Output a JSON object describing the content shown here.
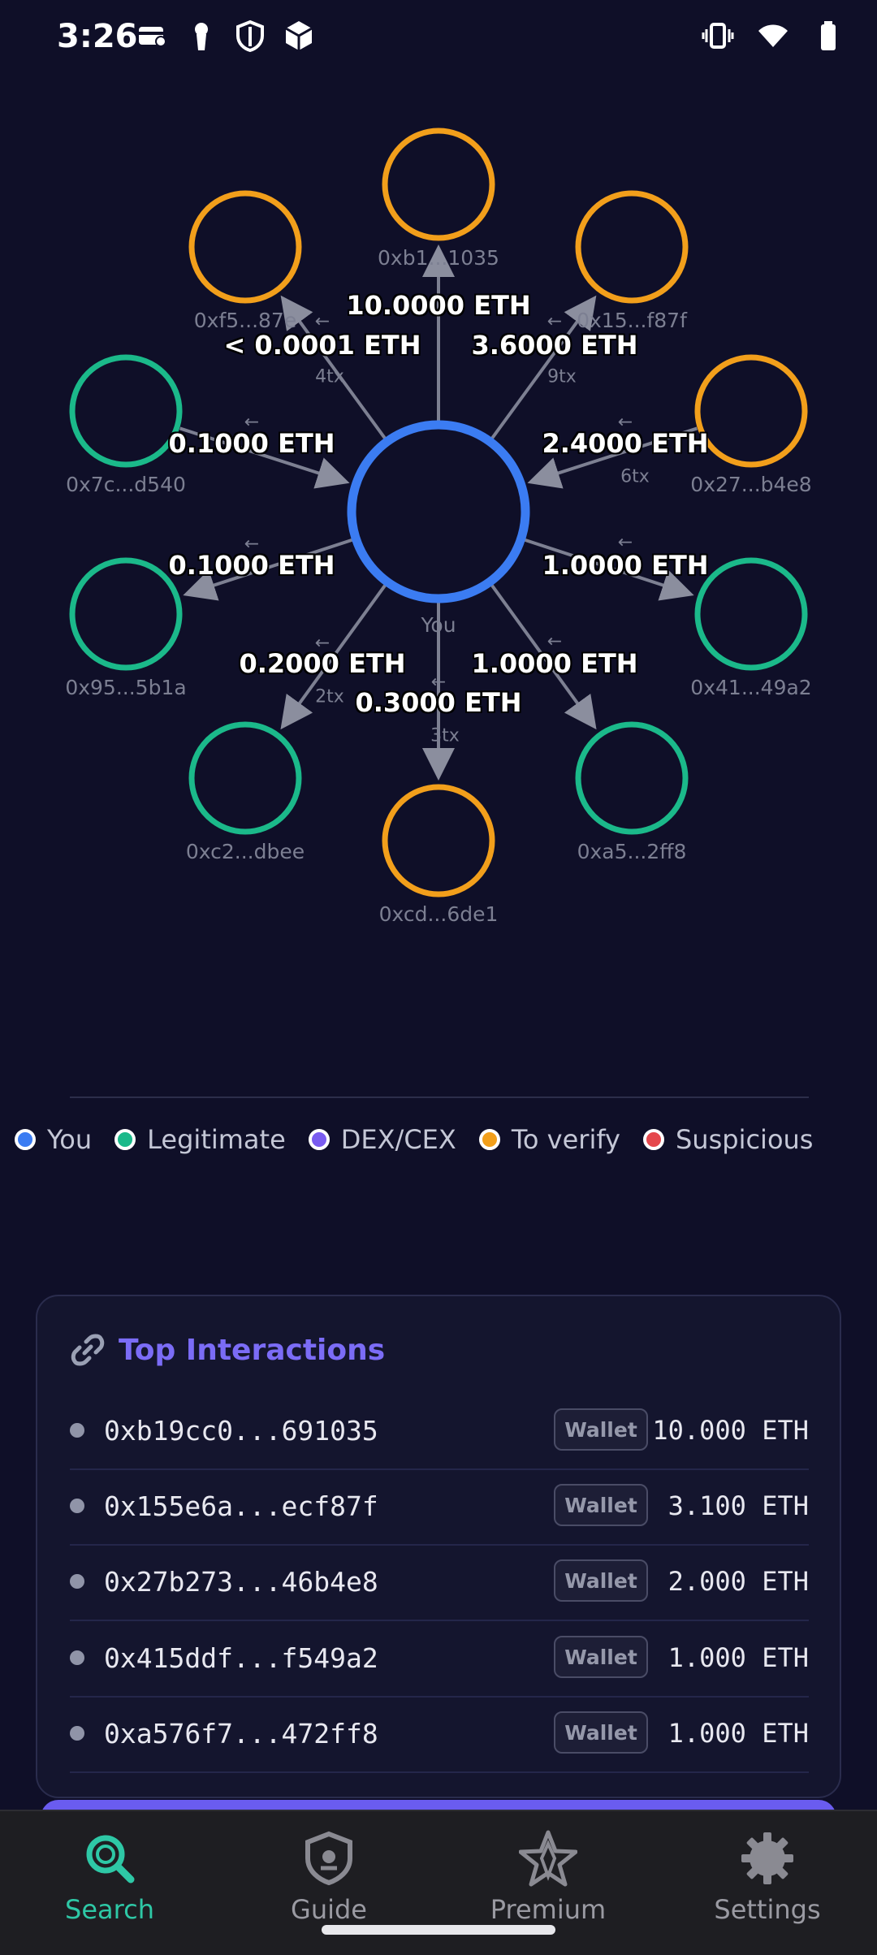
{
  "status_bar": {
    "time": "3:26",
    "left_icons": [
      "card-icon",
      "keyhole-icon",
      "shield-icon",
      "box-icon"
    ],
    "right_icons": [
      "vibrate-icon",
      "wifi-icon",
      "battery-icon"
    ]
  },
  "graph": {
    "center": {
      "label": "You",
      "color": "#3b7cf2"
    },
    "nodes": [
      {
        "id": "n0",
        "label": "0xb1...1035",
        "color": "#f29f1b"
      },
      {
        "id": "n1",
        "label": "0x15...f87f",
        "color": "#f29f1b"
      },
      {
        "id": "n2",
        "label": "0x27...b4e8",
        "color": "#f29f1b"
      },
      {
        "id": "n3",
        "label": "0x41...49a2",
        "color": "#1bb98a"
      },
      {
        "id": "n4",
        "label": "0xa5...2ff8",
        "color": "#1bb98a"
      },
      {
        "id": "n5",
        "label": "0xcd...6de1",
        "color": "#f29f1b"
      },
      {
        "id": "n6",
        "label": "0xc2...dbee",
        "color": "#1bb98a"
      },
      {
        "id": "n7",
        "label": "0x95...5b1a",
        "color": "#1bb98a"
      },
      {
        "id": "n8",
        "label": "0x7c...d540",
        "color": "#1bb98a"
      },
      {
        "id": "n9",
        "label": "0xf5...87e",
        "color": "#f29f1b"
      }
    ],
    "edges": [
      {
        "amount": "10.0000 ETH",
        "tx": "",
        "arrow": ""
      },
      {
        "amount": "3.6000 ETH",
        "tx": "9tx",
        "arrow": "←"
      },
      {
        "amount": "2.4000 ETH",
        "tx": "6tx",
        "arrow": "←"
      },
      {
        "amount": "1.0000 ETH",
        "tx": "",
        "arrow": "←"
      },
      {
        "amount": "1.0000 ETH",
        "tx": "",
        "arrow": "←"
      },
      {
        "amount": "0.3000 ETH",
        "tx": "3tx",
        "arrow": "←"
      },
      {
        "amount": "0.2000 ETH",
        "tx": "2tx",
        "arrow": "←"
      },
      {
        "amount": "0.1000 ETH",
        "tx": "",
        "arrow": "←"
      },
      {
        "amount": "0.1000 ETH",
        "tx": "",
        "arrow": "←"
      },
      {
        "amount": "< 0.0001 ETH",
        "tx": "4tx",
        "arrow": "←"
      }
    ]
  },
  "legend": [
    {
      "label": "You",
      "color": "#3b7cf2"
    },
    {
      "label": "Legitimate",
      "color": "#1bb98a"
    },
    {
      "label": "DEX/CEX",
      "color": "#7a5cf0"
    },
    {
      "label": "To verify",
      "color": "#f29f1b"
    },
    {
      "label": "Suspicious",
      "color": "#e5484d"
    }
  ],
  "top_interactions": {
    "title": "Top Interactions",
    "icon": "link-icon",
    "rows": [
      {
        "address": "0xb19cc0...691035",
        "badge": "Wallet",
        "amount": "10.000 ETH"
      },
      {
        "address": "0x155e6a...ecf87f",
        "badge": "Wallet",
        "amount": "3.100 ETH"
      },
      {
        "address": "0x27b273...46b4e8",
        "badge": "Wallet",
        "amount": "2.000 ETH"
      },
      {
        "address": "0x415ddf...f549a2",
        "badge": "Wallet",
        "amount": "1.000 ETH"
      },
      {
        "address": "0xa576f7...472ff8",
        "badge": "Wallet",
        "amount": "1.000 ETH"
      }
    ]
  },
  "bottom_nav": {
    "items": [
      {
        "label": "Search",
        "icon": "search-icon",
        "active": true
      },
      {
        "label": "Guide",
        "icon": "shield-icon",
        "active": false
      },
      {
        "label": "Premium",
        "icon": "star-icon",
        "active": false
      },
      {
        "label": "Settings",
        "icon": "gear-icon",
        "active": false
      }
    ]
  }
}
